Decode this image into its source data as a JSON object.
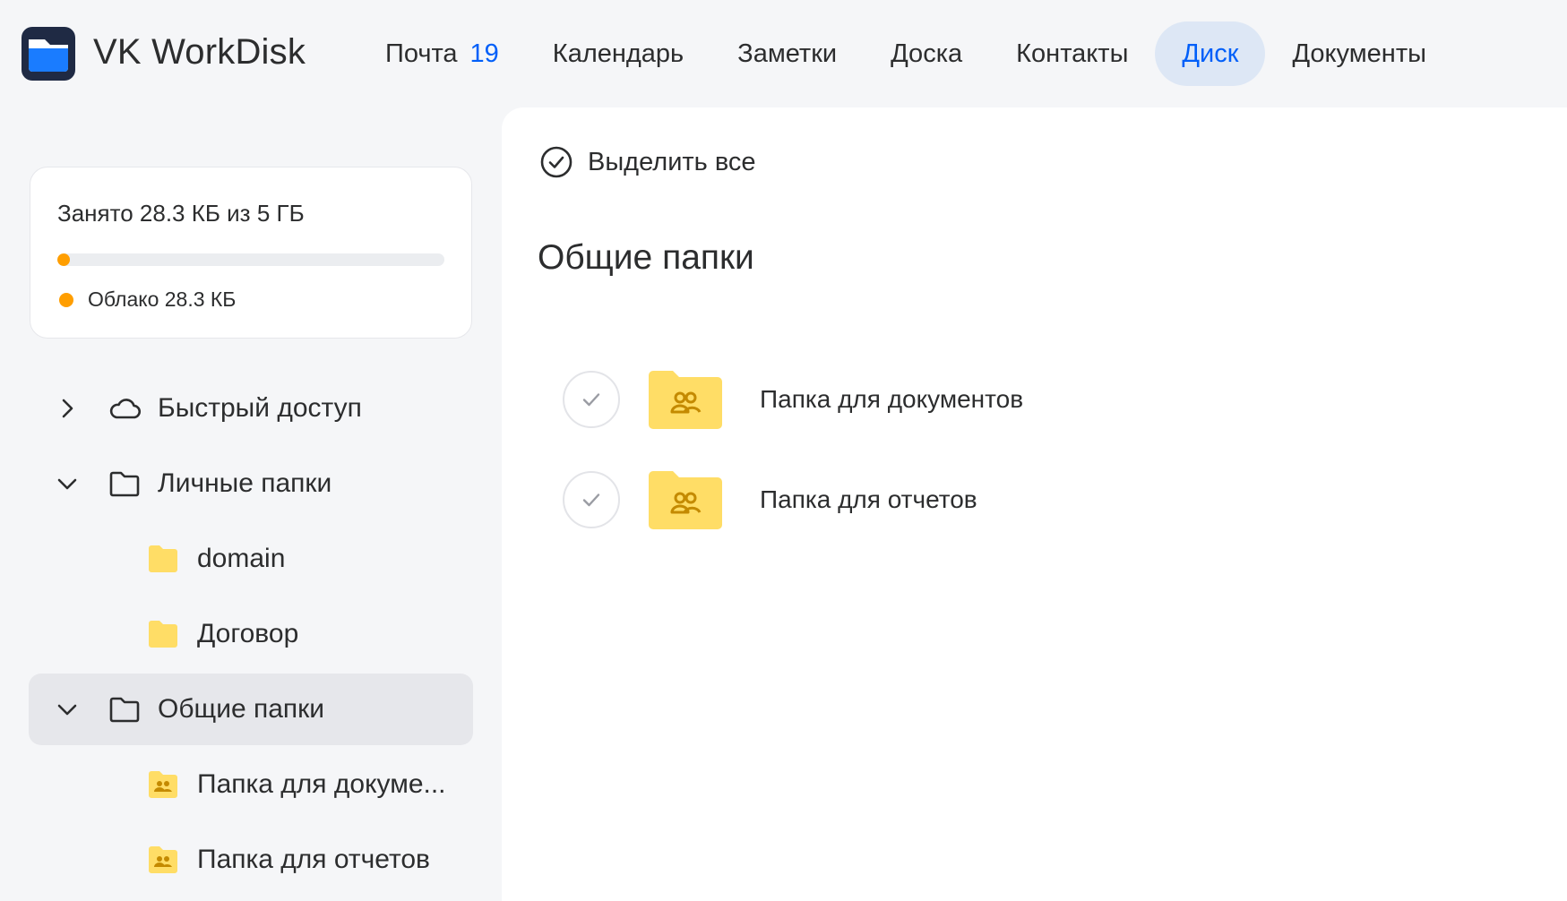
{
  "app": {
    "brand": "VK WorkDisk"
  },
  "nav": [
    {
      "label": "Почта",
      "count": "19"
    },
    {
      "label": "Календарь"
    },
    {
      "label": "Заметки"
    },
    {
      "label": "Доска"
    },
    {
      "label": "Контакты"
    },
    {
      "label": "Диск",
      "active": true
    },
    {
      "label": "Документы"
    }
  ],
  "storage": {
    "title": "Занято 28.3 КБ из 5 ГБ",
    "used_fraction": 5.3e-06,
    "legend": "Облако 28.3 КБ",
    "accent": "#ff9e00"
  },
  "sidebar": {
    "items": [
      {
        "label": "Быстрый доступ",
        "icon": "cloud-icon",
        "expanded": false
      },
      {
        "label": "Личные папки",
        "icon": "folder-outline-icon",
        "expanded": true
      },
      {
        "label": "domain",
        "icon": "folder-icon"
      },
      {
        "label": "Договор",
        "icon": "folder-icon"
      },
      {
        "label": "Общие папки",
        "icon": "folder-outline-icon",
        "expanded": true,
        "selected": true
      },
      {
        "label": "Папка для докуме...",
        "icon": "shared-folder-icon"
      },
      {
        "label": "Папка для отчетов",
        "icon": "shared-folder-icon"
      }
    ]
  },
  "main": {
    "select_all": "Выделить все",
    "section_title": "Общие папки",
    "files": [
      {
        "name": "Папка для документов",
        "icon": "shared-folder-icon"
      },
      {
        "name": "Папка для отчетов",
        "icon": "shared-folder-icon"
      }
    ]
  },
  "colors": {
    "accent": "#005ff9",
    "folder": "#ffdd66",
    "folder_icon": "#c48a00"
  }
}
